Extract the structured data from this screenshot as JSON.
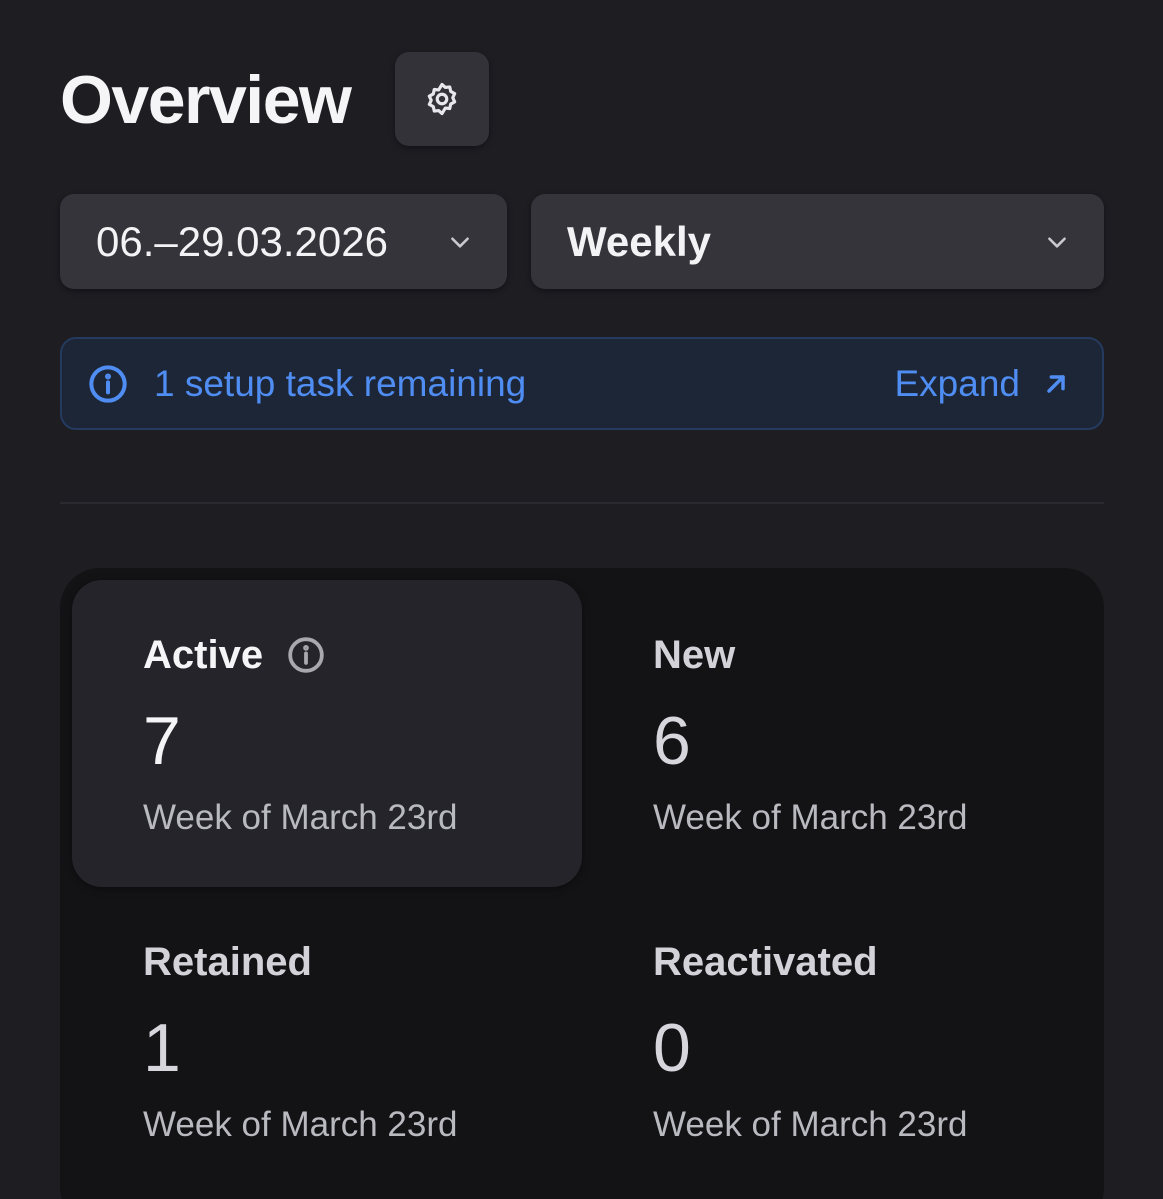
{
  "header": {
    "title": "Overview",
    "settings_icon": "gear-icon"
  },
  "filters": {
    "date_range": {
      "value": "06.–29.03.2026",
      "icon": "chevron-down-icon"
    },
    "frequency": {
      "value": "Weekly",
      "icon": "chevron-down-icon"
    }
  },
  "banner": {
    "icon": "info-icon",
    "text": "1 setup task remaining",
    "action_label": "Expand",
    "action_icon": "arrow-up-right-icon",
    "accent_color": "#4f8df3"
  },
  "stats": [
    {
      "label": "Active",
      "value": "7",
      "subtitle": "Week of March 23rd",
      "selected": true,
      "has_info": true
    },
    {
      "label": "New",
      "value": "6",
      "subtitle": "Week of March 23rd",
      "selected": false
    },
    {
      "label": "Retained",
      "value": "1",
      "subtitle": "Week of March 23rd",
      "selected": false
    },
    {
      "label": "Reactivated",
      "value": "0",
      "subtitle": "Week of March 23rd",
      "selected": false
    }
  ]
}
